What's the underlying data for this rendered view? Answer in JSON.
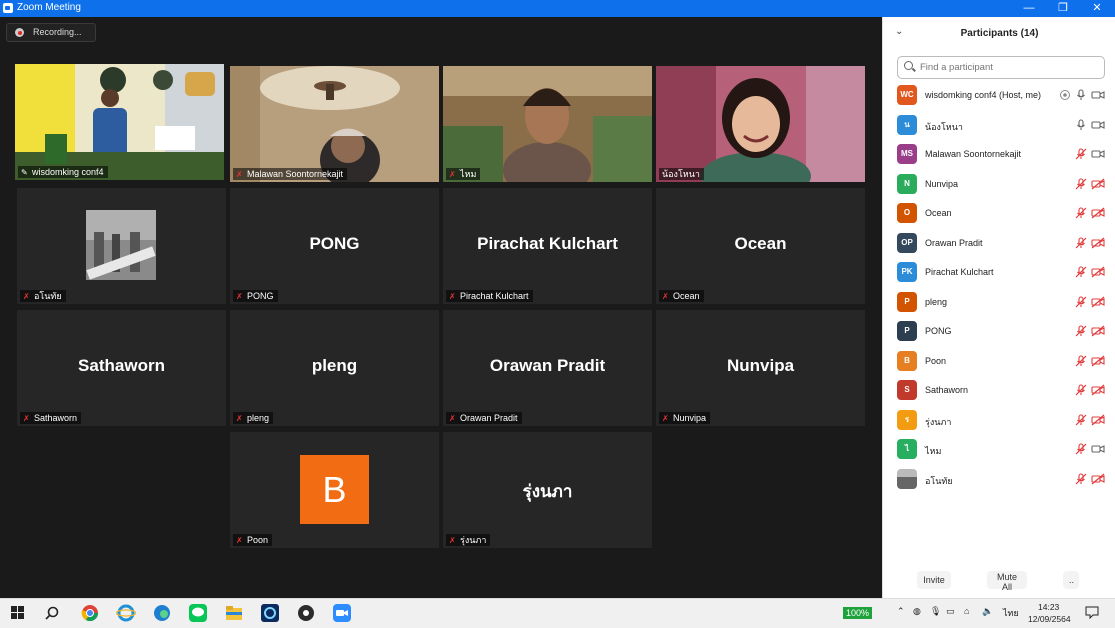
{
  "window": {
    "title": "Zoom Meeting",
    "minimize": "—",
    "restore": "❐",
    "close": "✕"
  },
  "recording": {
    "label": "Recording..."
  },
  "tiles": [
    {
      "name": "wisdomking conf4",
      "type": "video"
    },
    {
      "name": "Malawan Soontornekajit",
      "type": "video"
    },
    {
      "name": "ไหม",
      "type": "video"
    },
    {
      "name": "น้องโหนา",
      "type": "video"
    },
    {
      "name": "อโนทัย",
      "type": "image"
    },
    {
      "name": "PONG",
      "display": "PONG"
    },
    {
      "name": "Pirachat Kulchart",
      "display": "Pirachat Kulchart"
    },
    {
      "name": "Ocean",
      "display": "Ocean"
    },
    {
      "name": "Sathaworn",
      "display": "Sathaworn"
    },
    {
      "name": "pleng",
      "display": "pleng"
    },
    {
      "name": "Orawan Pradit",
      "display": "Orawan Pradit"
    },
    {
      "name": "Nunvipa",
      "display": "Nunvipa"
    },
    {
      "name": "Poon",
      "avatar": "B"
    },
    {
      "name": "รุ่งนภา",
      "display": "รุ่งนภา"
    }
  ],
  "panel": {
    "title": "Participants (14)",
    "search_placeholder": "Find a participant",
    "participants": [
      {
        "initials": "WC",
        "name": "wisdomking conf4 (Host, me)",
        "color": "#e2571e",
        "muted": false,
        "video": true
      },
      {
        "initials": "น",
        "name": "น้องโหนา",
        "color": "#2d8cd8",
        "muted": false,
        "video": true
      },
      {
        "initials": "MS",
        "name": "Malawan Soontornekajit",
        "color": "#9b3e8a",
        "muted": true,
        "video": true
      },
      {
        "initials": "N",
        "name": "Nunvipa",
        "color": "#2bac5c",
        "muted": true,
        "video": false
      },
      {
        "initials": "O",
        "name": "Ocean",
        "color": "#d35400",
        "muted": true,
        "video": false
      },
      {
        "initials": "OP",
        "name": "Orawan Pradit",
        "color": "#34495e",
        "muted": true,
        "video": false
      },
      {
        "initials": "PK",
        "name": "Pirachat Kulchart",
        "color": "#2d8cd8",
        "muted": true,
        "video": false
      },
      {
        "initials": "P",
        "name": "pleng",
        "color": "#d35400",
        "muted": true,
        "video": false
      },
      {
        "initials": "P",
        "name": "PONG",
        "color": "#2c3e50",
        "muted": true,
        "video": false
      },
      {
        "initials": "B",
        "name": "Poon",
        "color": "#e67e22",
        "muted": true,
        "video": false
      },
      {
        "initials": "S",
        "name": "Sathaworn",
        "color": "#c0392b",
        "muted": true,
        "video": false
      },
      {
        "initials": "ร",
        "name": "รุ่งนภา",
        "color": "#f39c12",
        "muted": true,
        "video": false
      },
      {
        "initials": "ไ",
        "name": "ไหม",
        "color": "#27ae60",
        "muted": true,
        "video": true
      },
      {
        "initials": "",
        "name": "อโนทัย",
        "color": "#7a7a7a",
        "muted": true,
        "video": false
      }
    ],
    "invite": "Invite",
    "mute_all": "Mute All",
    "more": ".."
  },
  "taskbar": {
    "battery": "100%",
    "lang": "ไทย",
    "time": "14:23",
    "date": "12/09/2564"
  }
}
